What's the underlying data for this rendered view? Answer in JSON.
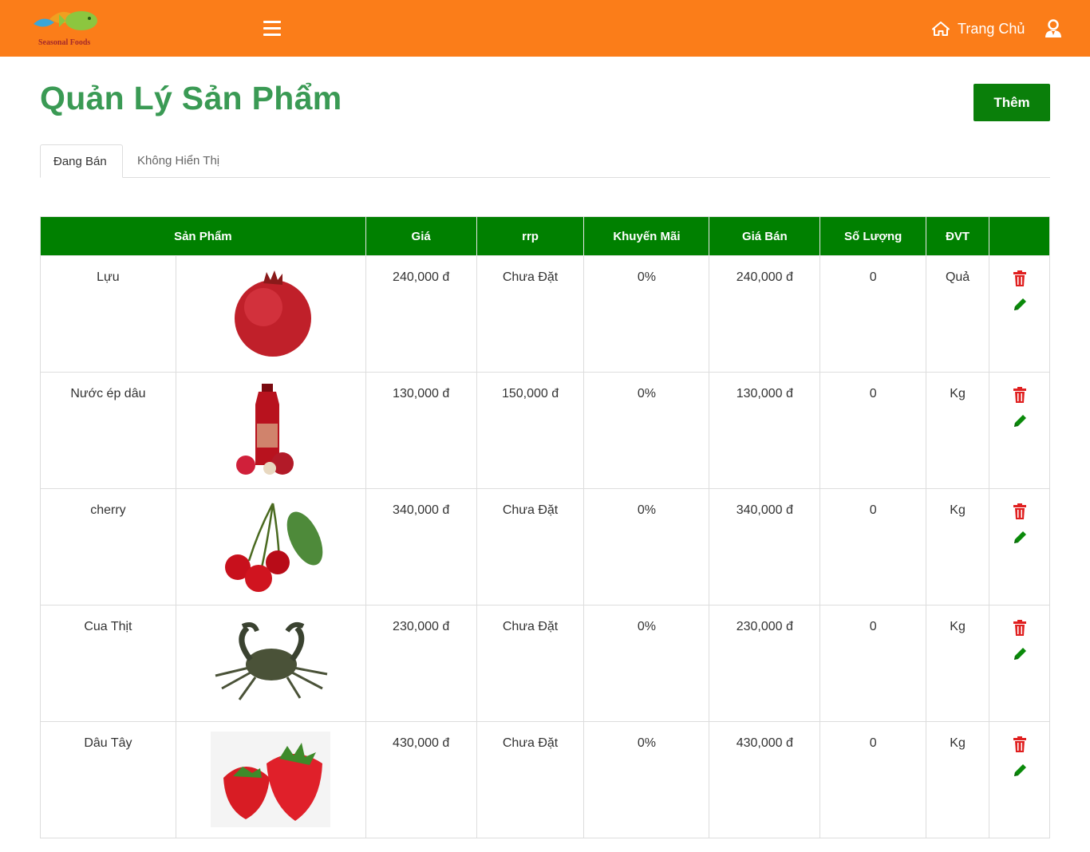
{
  "header": {
    "logo_text": "Seasonal Foods",
    "home_label": "Trang Chủ",
    "colors": {
      "bar": "#fb7d19",
      "primary_green": "#008000"
    }
  },
  "page": {
    "title": "Quản Lý Sản Phẩm",
    "add_label": "Thêm"
  },
  "tabs": [
    {
      "label": "Đang Bán",
      "active": true
    },
    {
      "label": "Không Hiển Thị",
      "active": false
    }
  ],
  "table": {
    "headers": [
      "Sản Phẩm",
      "Giá",
      "rrp",
      "Khuyến Mãi",
      "Giá Bán",
      "Số Lượng",
      "ĐVT",
      ""
    ],
    "rows": [
      {
        "name": "Lựu",
        "image": "pomegranate",
        "price": "240,000 đ",
        "rrp": "Chưa Đặt",
        "promo": "0%",
        "sale": "240,000 đ",
        "qty": "0",
        "unit": "Quả"
      },
      {
        "name": "Nước ép dâu",
        "image": "strawberry-juice-bottle",
        "price": "130,000 đ",
        "rrp": "150,000 đ",
        "promo": "0%",
        "sale": "130,000 đ",
        "qty": "0",
        "unit": "Kg"
      },
      {
        "name": "cherry",
        "image": "cherries",
        "price": "340,000 đ",
        "rrp": "Chưa Đặt",
        "promo": "0%",
        "sale": "340,000 đ",
        "qty": "0",
        "unit": "Kg"
      },
      {
        "name": "Cua Thịt",
        "image": "crab",
        "price": "230,000 đ",
        "rrp": "Chưa Đặt",
        "promo": "0%",
        "sale": "230,000 đ",
        "qty": "0",
        "unit": "Kg"
      },
      {
        "name": "Dâu Tây",
        "image": "strawberries",
        "price": "430,000 đ",
        "rrp": "Chưa Đặt",
        "promo": "0%",
        "sale": "430,000 đ",
        "qty": "0",
        "unit": "Kg"
      }
    ]
  }
}
